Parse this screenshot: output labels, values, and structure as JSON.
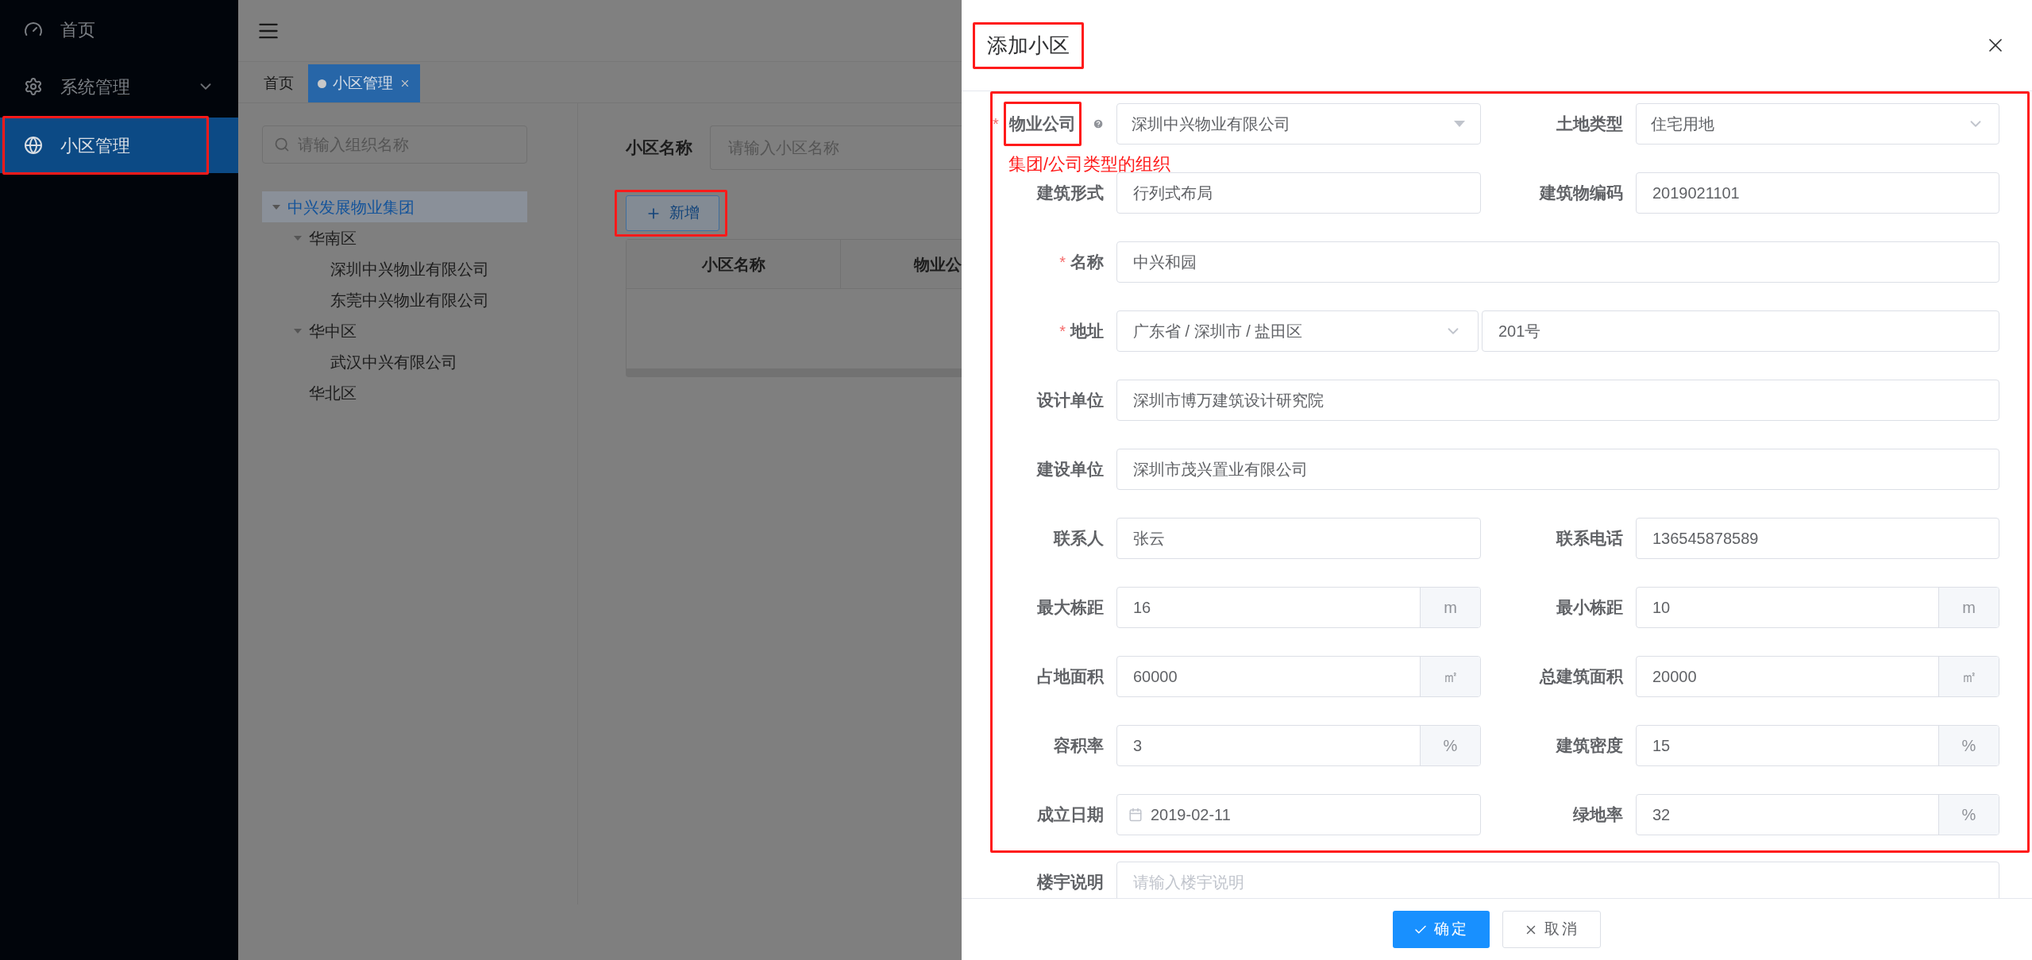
{
  "sidebar": {
    "items": [
      {
        "label": "首页",
        "selected": false,
        "expandable": false,
        "highlighted": false
      },
      {
        "label": "系统管理",
        "selected": false,
        "expandable": true,
        "highlighted": false
      },
      {
        "label": "小区管理",
        "selected": true,
        "expandable": false,
        "highlighted": true
      }
    ]
  },
  "tabs": [
    {
      "label": "首页",
      "selected": false,
      "closable": false
    },
    {
      "label": "小区管理",
      "selected": true,
      "closable": true
    }
  ],
  "tree": {
    "search_placeholder": "请输入组织名称",
    "nodes": [
      {
        "label": "中兴发展物业集团",
        "selected": true,
        "expanded": true,
        "children": [
          {
            "label": "华南区",
            "selected": false,
            "expanded": true,
            "children": [
              {
                "label": "深圳中兴物业有限公司",
                "selected": false
              },
              {
                "label": "东莞中兴物业有限公司",
                "selected": false
              }
            ]
          },
          {
            "label": "华中区",
            "selected": false,
            "expanded": true,
            "children": [
              {
                "label": "武汉中兴有限公司",
                "selected": false
              }
            ]
          },
          {
            "label": "华北区",
            "selected": false
          }
        ]
      }
    ]
  },
  "filter": {
    "label": "小区名称",
    "placeholder": "请输入小区名称"
  },
  "add_button": {
    "label": "新增",
    "highlighted": true
  },
  "table": {
    "columns": [
      "小区名称",
      "物业公"
    ]
  },
  "drawer": {
    "title": "添加小区",
    "title_highlighted": true,
    "form_highlighted": true,
    "rows": [
      {
        "fields": [
          {
            "label": "物业公司",
            "required_mark": "*",
            "help": true,
            "highlighted": true,
            "note": "集团/公司类型的组织",
            "kind": "tree-select",
            "value": "深圳中兴物业有限公司"
          },
          {
            "label": "土地类型",
            "kind": "select",
            "value": "住宅用地"
          }
        ]
      },
      {
        "fields": [
          {
            "label": "建筑形式",
            "kind": "text",
            "value": "行列式布局"
          },
          {
            "label": "建筑物编码",
            "kind": "text",
            "value": "2019021101"
          }
        ]
      },
      {
        "fields": [
          {
            "label": "名称",
            "required_mark": "*",
            "kind": "text",
            "value": "中兴和园"
          }
        ]
      },
      {
        "fields": [
          {
            "label": "地址",
            "required_mark": "*",
            "kind": "address",
            "value": "广东省 / 深圳市 / 盐田区",
            "detail": "201号"
          }
        ]
      },
      {
        "fields": [
          {
            "label": "设计单位",
            "kind": "text",
            "value": "深圳市博万建筑设计研究院"
          }
        ]
      },
      {
        "fields": [
          {
            "label": "建设单位",
            "kind": "text",
            "value": "深圳市茂兴置业有限公司"
          }
        ]
      },
      {
        "fields": [
          {
            "label": "联系人",
            "kind": "text",
            "value": "张云"
          },
          {
            "label": "联系电话",
            "kind": "text",
            "value": "136545878589"
          }
        ]
      },
      {
        "fields": [
          {
            "label": "最大栋距",
            "kind": "unit",
            "value": "16",
            "unit": "m"
          },
          {
            "label": "最小栋距",
            "kind": "unit",
            "value": "10",
            "unit": "m"
          }
        ]
      },
      {
        "fields": [
          {
            "label": "占地面积",
            "kind": "unit",
            "value": "60000",
            "unit": "㎡"
          },
          {
            "label": "总建筑面积",
            "kind": "unit",
            "value": "20000",
            "unit": "㎡"
          }
        ]
      },
      {
        "fields": [
          {
            "label": "容积率",
            "kind": "unit",
            "value": "3",
            "unit": "%"
          },
          {
            "label": "建筑密度",
            "kind": "unit",
            "value": "15",
            "unit": "%"
          }
        ]
      },
      {
        "fields": [
          {
            "label": "成立日期",
            "kind": "date",
            "value": "2019-02-11"
          },
          {
            "label": "绿地率",
            "kind": "unit",
            "value": "32",
            "unit": "%"
          }
        ]
      }
    ],
    "extra_field": {
      "label": "楼宇说明",
      "kind": "textarea",
      "placeholder": "请输入楼宇说明"
    },
    "buttons": [
      {
        "label": "确定",
        "kind": "primary"
      },
      {
        "label": "取消",
        "kind": "default"
      }
    ]
  }
}
